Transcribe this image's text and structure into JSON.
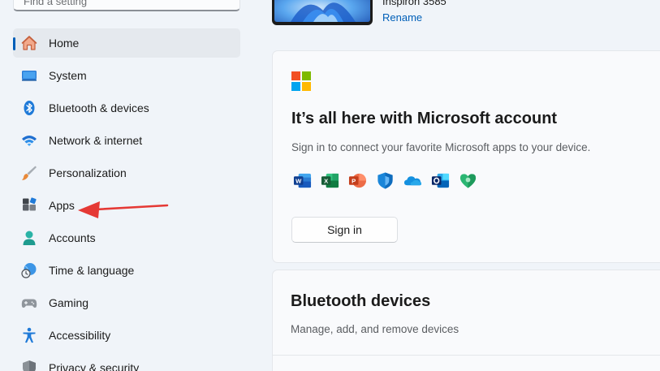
{
  "search": {
    "placeholder": "Find a setting"
  },
  "sidebar": {
    "items": [
      {
        "label": "Home",
        "icon": "home-icon",
        "selected": true
      },
      {
        "label": "System",
        "icon": "system-icon"
      },
      {
        "label": "Bluetooth & devices",
        "icon": "bluetooth-icon"
      },
      {
        "label": "Network & internet",
        "icon": "wifi-icon"
      },
      {
        "label": "Personalization",
        "icon": "brush-icon"
      },
      {
        "label": "Apps",
        "icon": "apps-icon"
      },
      {
        "label": "Accounts",
        "icon": "accounts-icon"
      },
      {
        "label": "Time & language",
        "icon": "globe-clock-icon"
      },
      {
        "label": "Gaming",
        "icon": "gamepad-icon"
      },
      {
        "label": "Accessibility",
        "icon": "accessibility-icon"
      },
      {
        "label": "Privacy & security",
        "icon": "shield-icon"
      }
    ]
  },
  "device": {
    "name": "Inspiron 3585",
    "rename_label": "Rename"
  },
  "ms_card": {
    "title": "It’s all here with Microsoft account",
    "subtitle": "Sign in to connect your favorite Microsoft apps to your device.",
    "apps": [
      "word-icon",
      "excel-icon",
      "powerpoint-icon",
      "defender-icon",
      "onedrive-icon",
      "outlook-icon",
      "family-safety-icon"
    ],
    "signin_label": "Sign in"
  },
  "bt_card": {
    "title": "Bluetooth devices",
    "subtitle": "Manage, add, and remove devices"
  },
  "colors": {
    "accent": "#005fb8",
    "annotation_arrow": "#e53935",
    "background": "#f0f4f9"
  }
}
